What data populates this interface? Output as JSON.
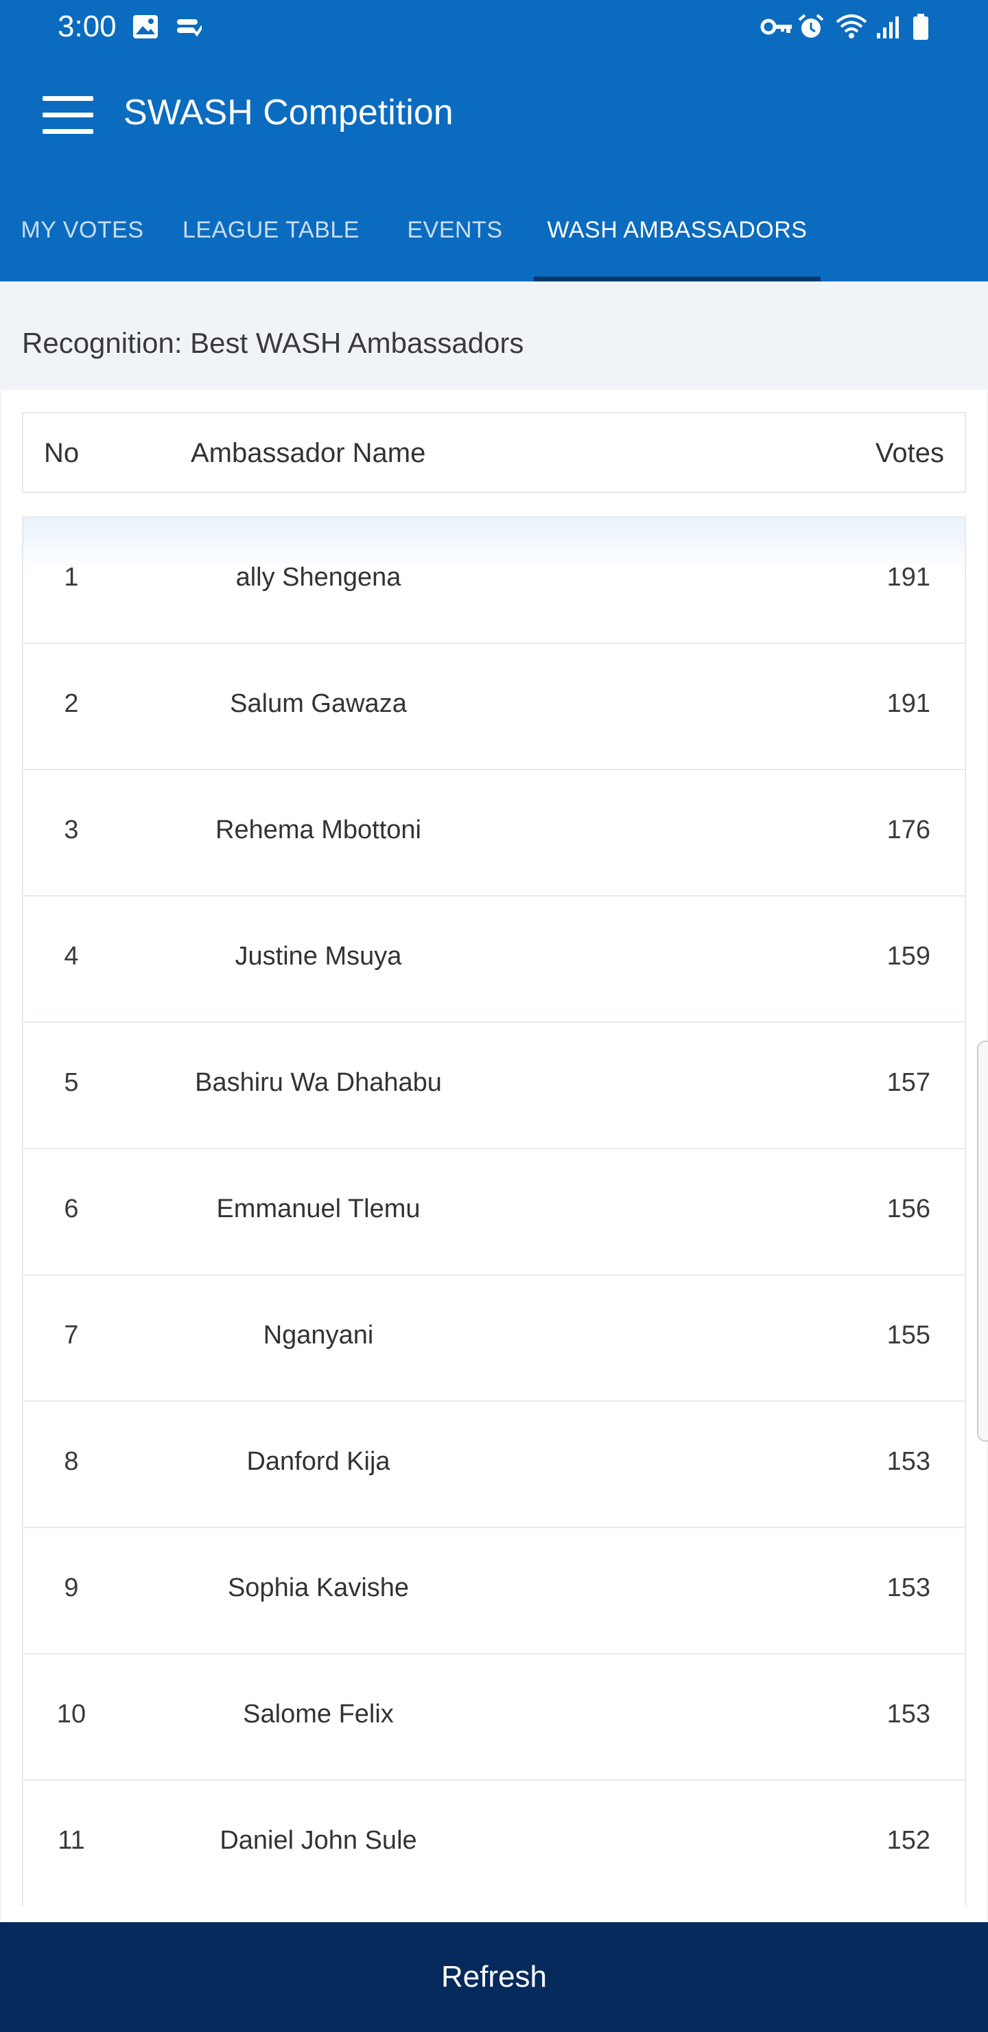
{
  "status_bar": {
    "time": "3:00",
    "icons": [
      "image-icon",
      "sync-icon",
      "key-icon",
      "alarm-icon",
      "wifi-icon",
      "signal-icon",
      "battery-icon"
    ]
  },
  "app_bar": {
    "title": "SWASH Competition",
    "menu_icon": "hamburger-menu-icon"
  },
  "tabs": [
    {
      "label": "MY VOTES",
      "active": false
    },
    {
      "label": "LEAGUE TABLE",
      "active": false
    },
    {
      "label": "EVENTS",
      "active": false
    },
    {
      "label": "WASH AMBASSADORS",
      "active": true
    }
  ],
  "section": {
    "title": "Recognition: Best WASH Ambassadors"
  },
  "table": {
    "headers": {
      "no": "No",
      "name": "Ambassador Name",
      "votes": "Votes"
    },
    "rows": [
      {
        "no": "1",
        "name": "ally Shengena",
        "votes": "191"
      },
      {
        "no": "2",
        "name": "Salum Gawaza",
        "votes": "191"
      },
      {
        "no": "3",
        "name": "Rehema Mbottoni",
        "votes": "176"
      },
      {
        "no": "4",
        "name": "Justine Msuya",
        "votes": "159"
      },
      {
        "no": "5",
        "name": "Bashiru Wa Dhahabu",
        "votes": "157"
      },
      {
        "no": "6",
        "name": "Emmanuel Tlemu",
        "votes": "156"
      },
      {
        "no": "7",
        "name": "Nganyani",
        "votes": "155"
      },
      {
        "no": "8",
        "name": "Danford Kija",
        "votes": "153"
      },
      {
        "no": "9",
        "name": "Sophia Kavishe",
        "votes": "153"
      },
      {
        "no": "10",
        "name": "Salome Felix",
        "votes": "153"
      },
      {
        "no": "11",
        "name": "Daniel John Sule",
        "votes": "152"
      }
    ]
  },
  "footer": {
    "refresh_label": "Refresh"
  },
  "colors": {
    "primary": "#0b6bbf",
    "tab_indicator": "#0a3868",
    "footer": "#072a5c",
    "background": "#f0f4f9"
  }
}
